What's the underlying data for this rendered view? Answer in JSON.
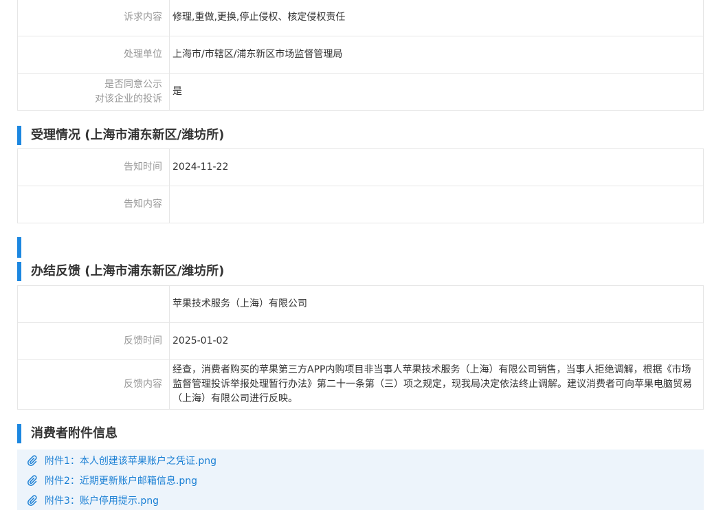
{
  "complaint": {
    "rows": [
      {
        "label": "诉求内容",
        "value": "修理,重做,更换,停止侵权、核定侵权责任"
      },
      {
        "label": "处理单位",
        "value": "上海市/市辖区/浦东新区市场监督管理局"
      },
      {
        "label_lines": [
          "是否同意公示",
          "对该企业的投诉"
        ],
        "value": "是"
      }
    ]
  },
  "acceptance": {
    "title": "受理情况 (上海市浦东新区/潍坊所)",
    "rows": [
      {
        "label": "告知时间",
        "value": "2024-11-22"
      },
      {
        "label": "告知内容"
      }
    ]
  },
  "feedback": {
    "title": "办结反馈 (上海市浦东新区/潍坊所)",
    "rows": [
      {
        "value": "苹果技术服务（上海）有限公司"
      },
      {
        "label": "反馈时间",
        "value": "2025-01-02"
      },
      {
        "label": "反馈内容",
        "value": "经查，消费者购买的苹果第三方APP内购项目非当事人苹果技术服务（上海）有限公司销售，当事人拒绝调解，根据《市场监督管理投诉举报处理暂行办法》第二十一条第（三）项之规定，现我局决定依法终止调解。建议消费者可向苹果电脑贸易（上海）有限公司进行反映。"
      }
    ]
  },
  "attachments": {
    "title": "消费者附件信息",
    "items": [
      {
        "icon": "paperclip-icon",
        "name": "附件1：本人创建该苹果账户之凭证.png"
      },
      {
        "icon": "paperclip-icon",
        "name": "附件2：近期更新账户邮箱信息.png"
      },
      {
        "icon": "paperclip-icon",
        "name": "附件3：账户停用提示.png"
      }
    ]
  },
  "colors": {
    "accent": "#1c87e0",
    "text": "#333333",
    "label": "#999999",
    "border": "#e6e6e6",
    "link": "#1a7fd4",
    "attachment_bg": "#edf4fb"
  }
}
